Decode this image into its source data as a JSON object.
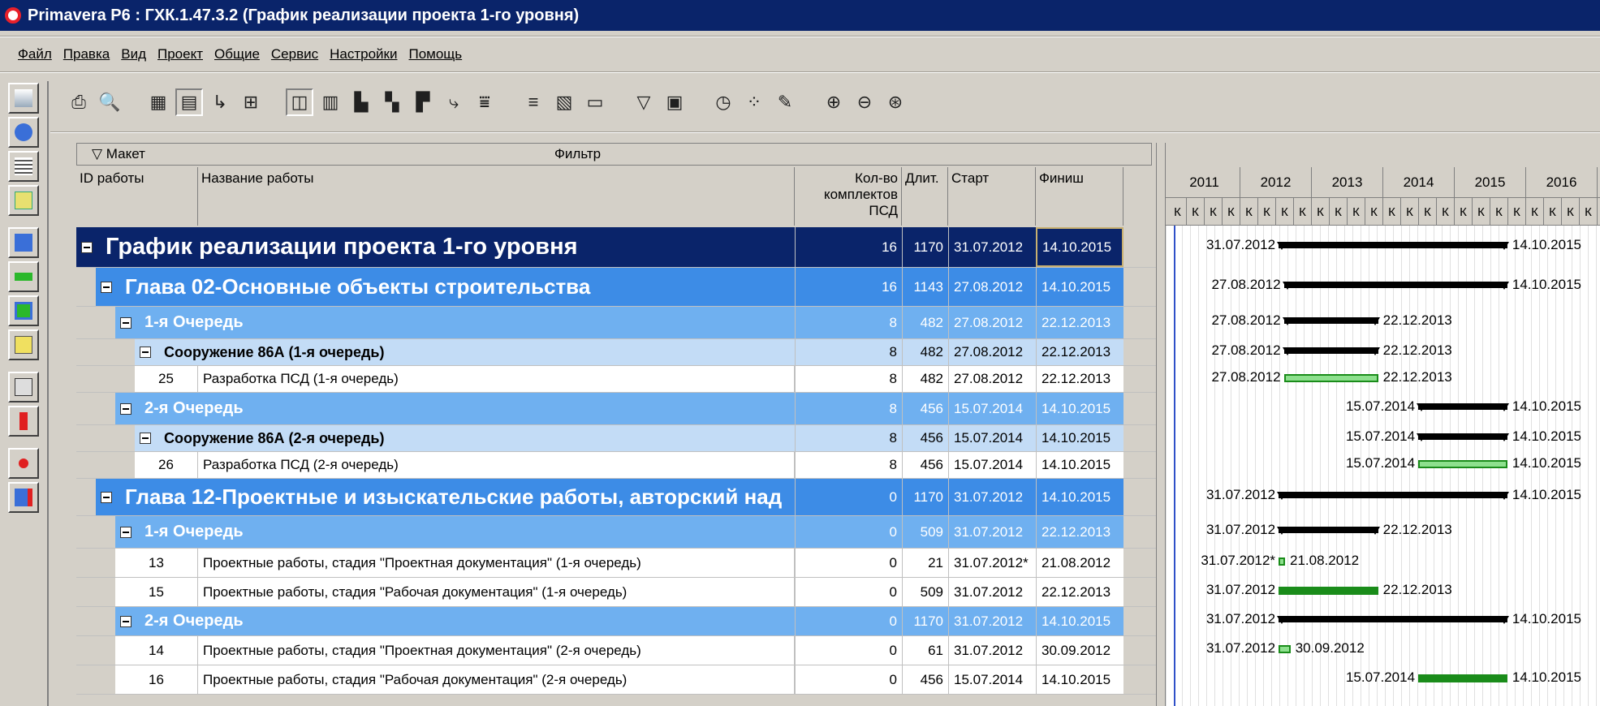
{
  "window": {
    "title": "Primavera P6 : ГХК.1.47.3.2 (График реализации проекта 1-го уровня)"
  },
  "menu": [
    "Файл",
    "Правка",
    "Вид",
    "Проект",
    "Общие",
    "Сервис",
    "Настройки",
    "Помощь"
  ],
  "toolbar_icons": [
    "print-icon",
    "print-preview-icon",
    "columns-icon",
    "table-icon",
    "relationship-lines-icon",
    "network-icon",
    "layout-icon",
    "gantt-icon",
    "histogram-icon",
    "resource-profile-icon",
    "activity-usage-icon",
    "trace-icon",
    "level-icon",
    "group-sort-icon",
    "columns-select-icon",
    "bars-icon",
    "filter-icon",
    "layout-options-icon",
    "schedule-icon",
    "assign-icon",
    "progress-icon",
    "zoom-in-icon",
    "zoom-out-icon",
    "zoom-fit-icon"
  ],
  "panel": {
    "layout_label": "Макет",
    "filter_label": "Фильтр"
  },
  "columns": {
    "id": "ID работы",
    "name": "Название работы",
    "qty": "Кол-во комплектов ПСД",
    "dur": "Длит.",
    "start": "Старт",
    "finish": "Финиш"
  },
  "timescale": {
    "years": [
      "2011",
      "2012",
      "2013",
      "2014",
      "2015",
      "2016"
    ],
    "quarter_label": "К"
  },
  "rows": [
    {
      "level": 0,
      "id": "",
      "name": "График реализации проекта 1-го уровня",
      "qty": "16",
      "dur": "1170",
      "start": "31.07.2012",
      "finish": "14.10.2015",
      "bar_start": "31.07.2012",
      "bar_finish": "14.10.2015"
    },
    {
      "level": 1,
      "id": "",
      "name": "Глава 02-Основные объекты строительства",
      "qty": "16",
      "dur": "1143",
      "start": "27.08.2012",
      "finish": "14.10.2015",
      "bar_start": "27.08.2012",
      "bar_finish": "14.10.2015"
    },
    {
      "level": 2,
      "id": "",
      "name": "1-я Очередь",
      "qty": "8",
      "dur": "482",
      "start": "27.08.2012",
      "finish": "22.12.2013",
      "bar_start": "27.08.2012",
      "bar_finish": "22.12.2013"
    },
    {
      "level": 3,
      "id": "",
      "name": "Сооружение 86А (1-я очередь)",
      "qty": "8",
      "dur": "482",
      "start": "27.08.2012",
      "finish": "22.12.2013",
      "bar_start": "27.08.2012",
      "bar_finish": "22.12.2013"
    },
    {
      "level": 4,
      "id": "25",
      "name": "Разработка ПСД (1-я очередь)",
      "qty": "8",
      "dur": "482",
      "start": "27.08.2012",
      "finish": "22.12.2013",
      "bar_start": "27.08.2012",
      "bar_finish": "22.12.2013"
    },
    {
      "level": 2,
      "id": "",
      "name": "2-я Очередь",
      "qty": "8",
      "dur": "456",
      "start": "15.07.2014",
      "finish": "14.10.2015",
      "bar_start": "15.07.2014",
      "bar_finish": "14.10.2015"
    },
    {
      "level": 3,
      "id": "",
      "name": "Сооружение 86А (2-я очередь)",
      "qty": "8",
      "dur": "456",
      "start": "15.07.2014",
      "finish": "14.10.2015",
      "bar_start": "15.07.2014",
      "bar_finish": "14.10.2015"
    },
    {
      "level": 4,
      "id": "26",
      "name": "Разработка ПСД (2-я очередь)",
      "qty": "8",
      "dur": "456",
      "start": "15.07.2014",
      "finish": "14.10.2015",
      "bar_start": "15.07.2014",
      "bar_finish": "14.10.2015"
    },
    {
      "level": 1,
      "id": "",
      "name": "Глава 12-Проектные и изыскательские работы, авторский над",
      "qty": "0",
      "dur": "1170",
      "start": "31.07.2012",
      "finish": "14.10.2015",
      "bar_start": "31.07.2012",
      "bar_finish": "14.10.2015"
    },
    {
      "level": 2,
      "id": "",
      "name": "1-я Очередь",
      "qty": "0",
      "dur": "509",
      "start": "31.07.2012",
      "finish": "22.12.2013",
      "bar_start": "31.07.2012",
      "bar_finish": "22.12.2013"
    },
    {
      "level": 5,
      "id": "13",
      "name": "Проектные работы, стадия \"Проектная документация\" (1-я очередь)",
      "qty": "0",
      "dur": "21",
      "start": "31.07.2012*",
      "finish": "21.08.2012",
      "bar_start": "31.07.2012*",
      "bar_finish": "21.08.2012"
    },
    {
      "level": 5,
      "id": "15",
      "name": "Проектные работы, стадия \"Рабочая документация\" (1-я очередь)",
      "qty": "0",
      "dur": "509",
      "start": "31.07.2012",
      "finish": "22.12.2013",
      "bar_start": "31.07.2012",
      "bar_finish": "22.12.2013"
    },
    {
      "level": 2,
      "id": "",
      "name": "2-я Очередь",
      "qty": "0",
      "dur": "1170",
      "start": "31.07.2012",
      "finish": "14.10.2015",
      "bar_start": "31.07.2012",
      "bar_finish": "14.10.2015"
    },
    {
      "level": 5,
      "id": "14",
      "name": "Проектные работы, стадия \"Проектная документация\" (2-я очередь)",
      "qty": "0",
      "dur": "61",
      "start": "31.07.2012",
      "finish": "30.09.2012",
      "bar_start": "31.07.2012",
      "bar_finish": "30.09.2012"
    },
    {
      "level": 5,
      "id": "16",
      "name": "Проектные работы, стадия \"Рабочая документация\" (2-я очередь)",
      "qty": "0",
      "dur": "456",
      "start": "15.07.2014",
      "finish": "14.10.2015",
      "bar_start": "15.07.2014",
      "bar_finish": "14.10.2015"
    }
  ],
  "colors": {
    "level0": "#0a246a",
    "level1": "#3d8ce6",
    "level2": "#6fb0f0",
    "level3": "#c3dcf6",
    "level4": "#ffffff",
    "title_bar": "#0a246a",
    "bar_summary": "#000000",
    "bar_activity": "#1a8c1a"
  }
}
